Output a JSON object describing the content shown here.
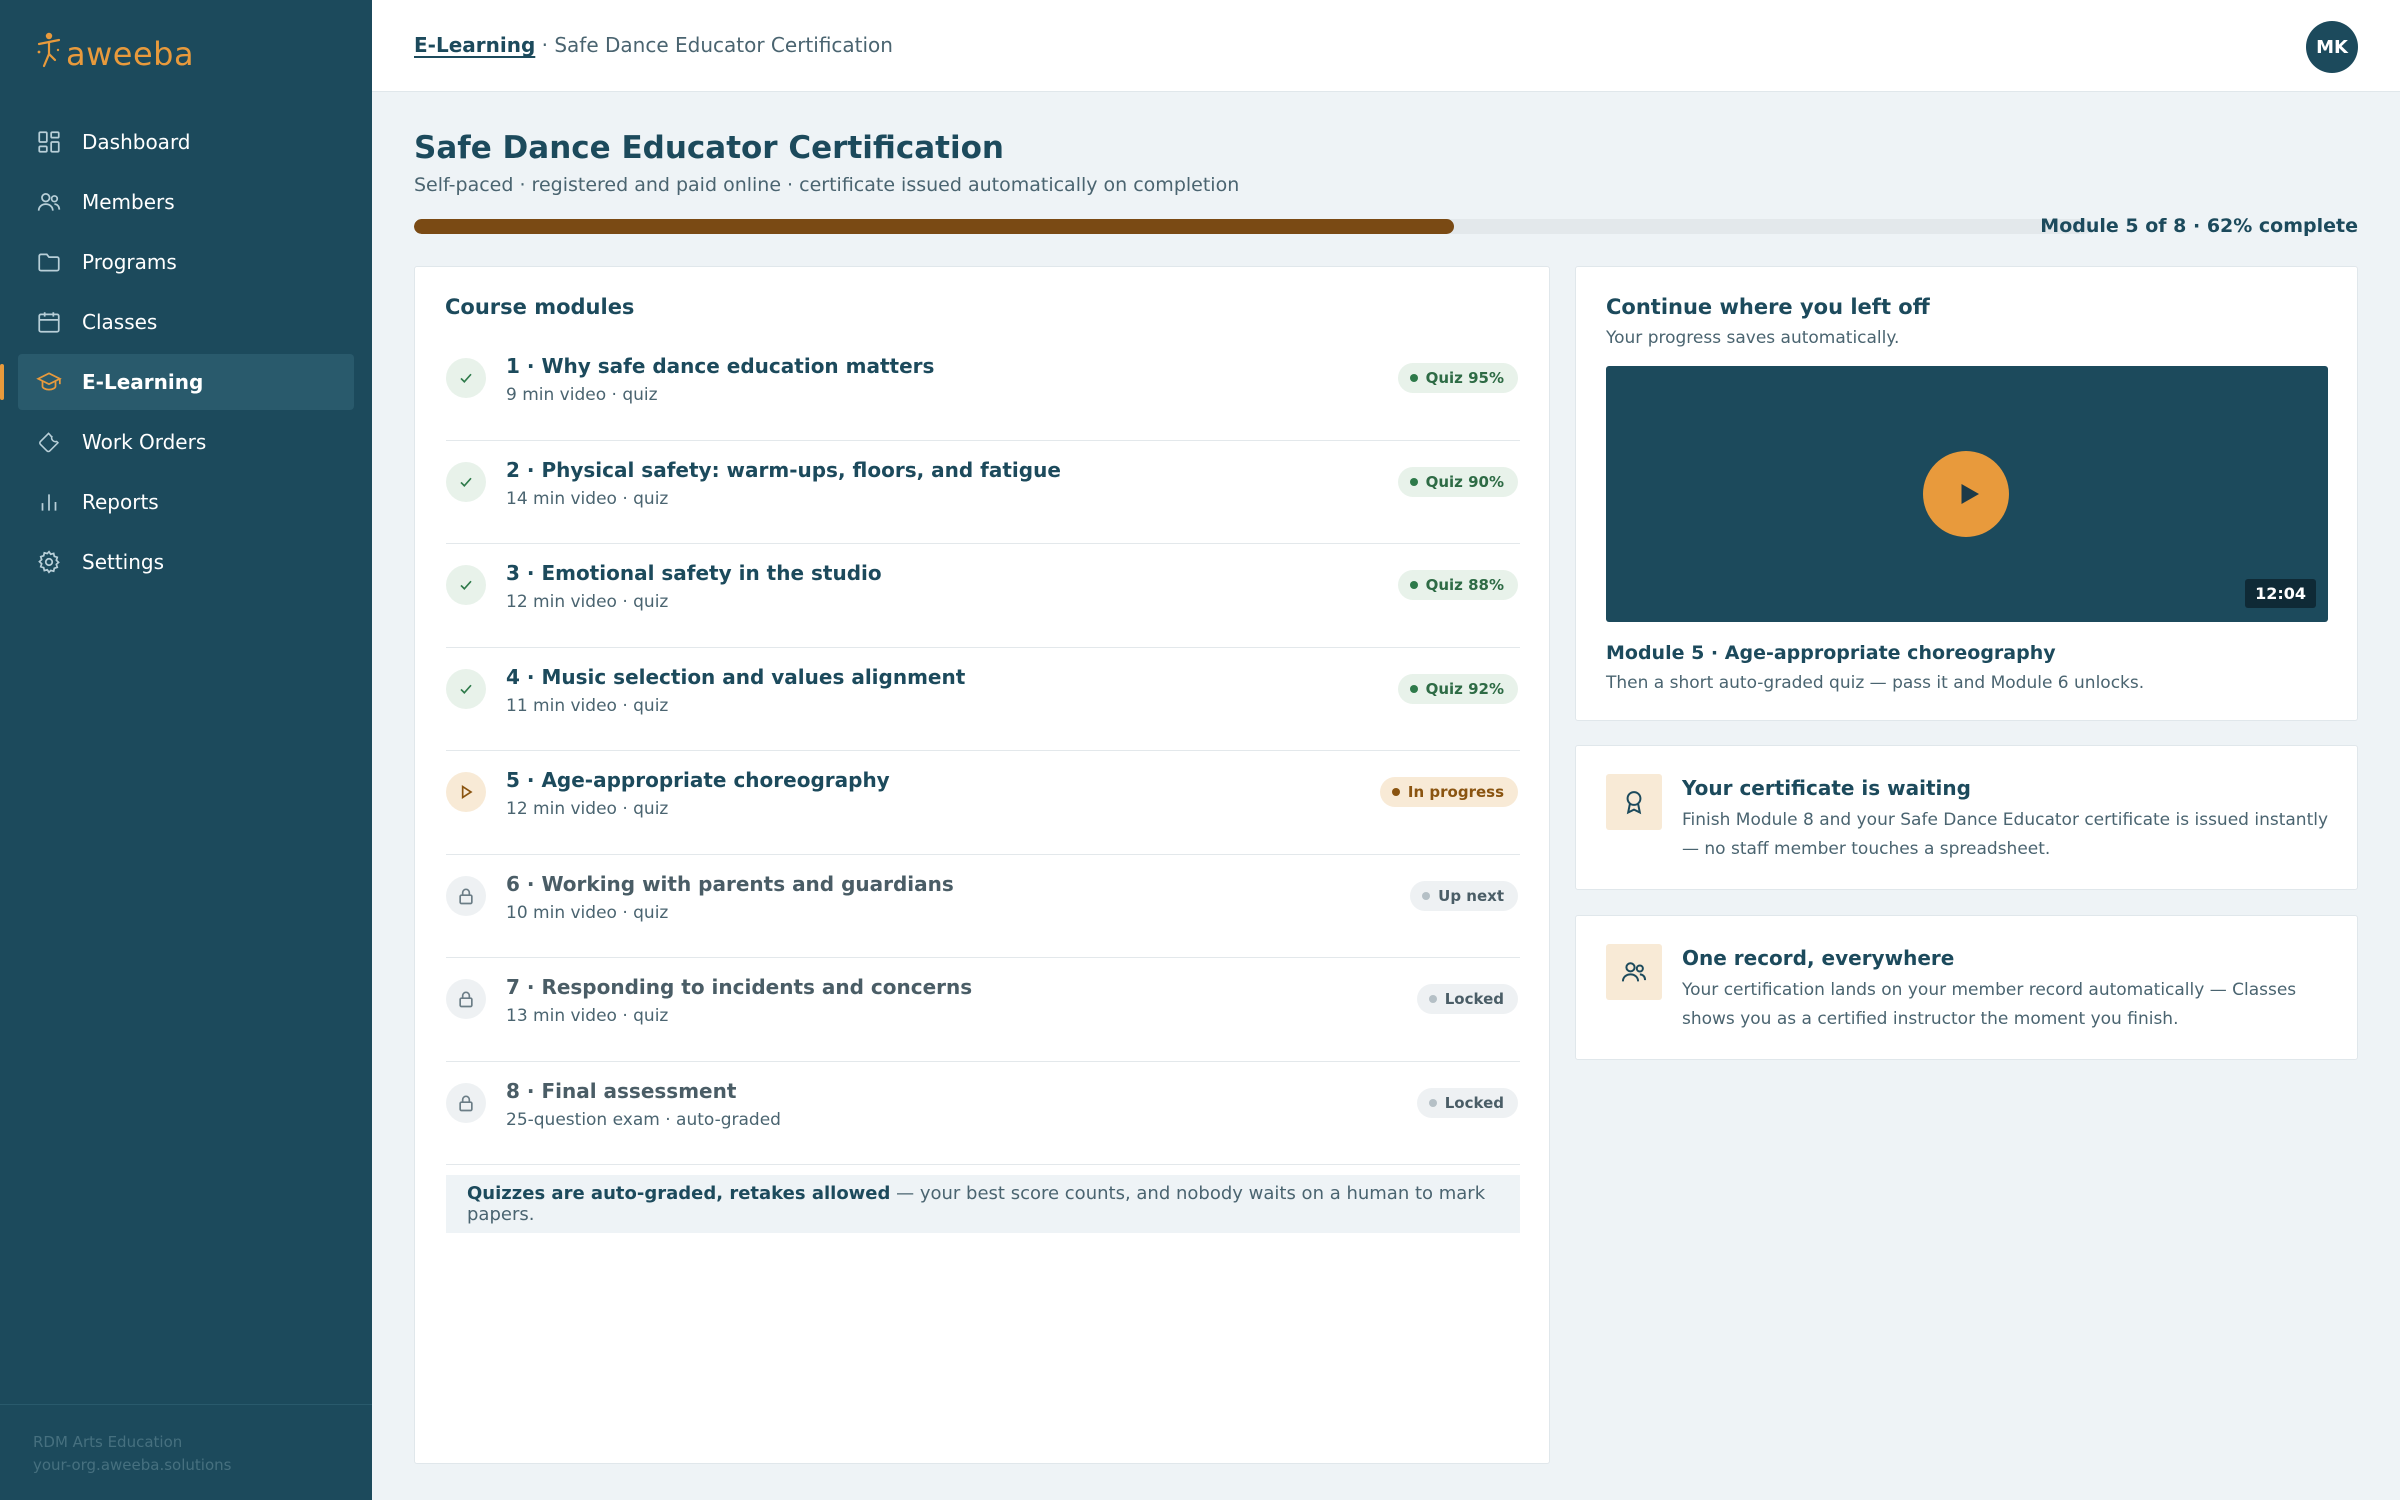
{
  "brand": {
    "name": "aweeba"
  },
  "nav": {
    "items": [
      {
        "label": "Dashboard",
        "icon": "grid-icon"
      },
      {
        "label": "Members",
        "icon": "users-icon"
      },
      {
        "label": "Programs",
        "icon": "folder-icon"
      },
      {
        "label": "Classes",
        "icon": "calendar-icon"
      },
      {
        "label": "E-Learning",
        "icon": "graduation-cap-icon",
        "active": true
      },
      {
        "label": "Work Orders",
        "icon": "wrench-icon"
      },
      {
        "label": "Reports",
        "icon": "bar-chart-icon"
      },
      {
        "label": "Settings",
        "icon": "gear-icon"
      }
    ]
  },
  "sidebar_footer": {
    "org": "RDM Arts Education",
    "domain": "your-org.aweeba.solutions"
  },
  "header": {
    "breadcrumb_root": "E-Learning",
    "breadcrumb_sep": " · ",
    "breadcrumb_current": "Safe Dance Educator Certification",
    "avatar_initials": "MK"
  },
  "course": {
    "title": "Safe Dance Educator Certification",
    "subtitle": "Self-paced · registered and paid online · certificate issued automatically on completion",
    "progress_percent": 62,
    "progress_label": "Module 5 of 8 · 62% complete"
  },
  "modules_card": {
    "title": "Course modules",
    "modules": [
      {
        "title": "1 · Why safe dance education matters",
        "meta": "9 min video · quiz",
        "status": "done",
        "badge": "Quiz 95%"
      },
      {
        "title": "2 · Physical safety: warm-ups, floors, and fatigue",
        "meta": "14 min video · quiz",
        "status": "done",
        "badge": "Quiz 90%"
      },
      {
        "title": "3 · Emotional safety in the studio",
        "meta": "12 min video · quiz",
        "status": "done",
        "badge": "Quiz 88%"
      },
      {
        "title": "4 · Music selection and values alignment",
        "meta": "11 min video · quiz",
        "status": "done",
        "badge": "Quiz 92%"
      },
      {
        "title": "5 · Age-appropriate choreography",
        "meta": "12 min video · quiz",
        "status": "progress",
        "badge": "In progress"
      },
      {
        "title": "6 · Working with parents and guardians",
        "meta": "10 min video · quiz",
        "status": "next",
        "badge": "Up next"
      },
      {
        "title": "7 · Responding to incidents and concerns",
        "meta": "13 min video · quiz",
        "status": "locked",
        "badge": "Locked"
      },
      {
        "title": "8 · Final assessment",
        "meta": "25-question exam · auto-graded",
        "status": "locked",
        "badge": "Locked"
      }
    ],
    "note_strong": "Quizzes are auto-graded, retakes allowed",
    "note_rest": " — your best score counts, and nobody waits on a human to mark papers."
  },
  "continue_card": {
    "title": "Continue where you left off",
    "subtitle": "Your progress saves automatically.",
    "video_duration": "12:04",
    "module_title": "Module 5 · Age-appropriate choreography",
    "module_desc": "Then a short auto-graded quiz — pass it and Module 6 unlocks."
  },
  "certificate_card": {
    "title": "Your certificate is waiting",
    "text": "Finish Module 8 and your Safe Dance Educator certificate is issued instantly — no staff member touches a spreadsheet."
  },
  "record_card": {
    "title": "One record, everywhere",
    "text": "Your certification lands on your member record automatically — Classes shows you as a certified instructor the moment you finish."
  },
  "colors": {
    "sidebar": "#1c4a5c",
    "accent": "#e89a3c",
    "progress_fill": "#7a4a14",
    "success": "#2e7a4a",
    "page_bg": "#eef3f6"
  }
}
